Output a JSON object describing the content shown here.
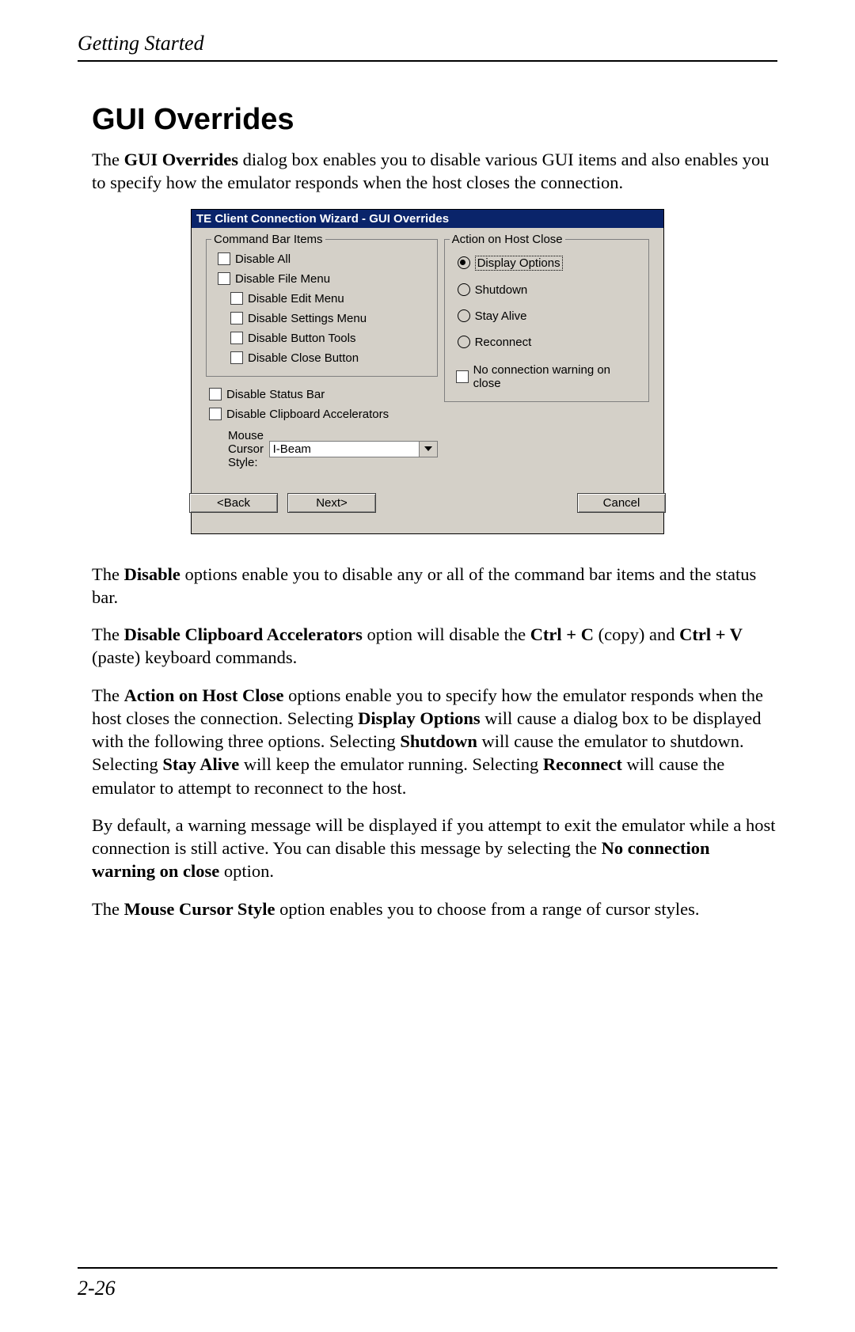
{
  "header": {
    "running_title": "Getting Started"
  },
  "section": {
    "title": "GUI Overrides"
  },
  "intro": {
    "p1_a": "The ",
    "p1_b": "GUI Overrides",
    "p1_c": " dialog box enables you to disable various GUI items and also enables you to specify how the emulator responds when the host closes the connection."
  },
  "dialog": {
    "title": "TE Client Connection Wizard - GUI Overrides",
    "group_cmd": {
      "legend": "Command Bar Items",
      "items": {
        "all": "Disable All",
        "file": "Disable File Menu",
        "edit": "Disable Edit Menu",
        "settings": "Disable Settings Menu",
        "tools": "Disable Button Tools",
        "close": "Disable Close Button"
      }
    },
    "status_bar": "Disable Status Bar",
    "clip_accel": "Disable Clipboard Accelerators",
    "mouse_label": "Mouse Cursor Style:",
    "mouse_value": "I-Beam",
    "group_action": {
      "legend": "Action on Host Close",
      "display": "Display Options",
      "shutdown": "Shutdown",
      "stay": "Stay Alive",
      "reconnect": "Reconnect",
      "nowarn": "No connection warning on close"
    },
    "buttons": {
      "back": "<Back",
      "next": "Next>",
      "cancel": "Cancel"
    }
  },
  "body": {
    "p2_a": "The ",
    "p2_b": "Disable",
    "p2_c": " options enable you to disable any or all of the command bar items and the status bar.",
    "p3_a": "The ",
    "p3_b": "Disable Clipboard Accelerators",
    "p3_c": " option will disable the ",
    "p3_d": "Ctrl + C",
    "p3_e": " (copy) and ",
    "p3_f": "Ctrl + V",
    "p3_g": " (paste) keyboard commands.",
    "p4_a": "The ",
    "p4_b": "Action on Host Close",
    "p4_c": " options enable you to specify how the emulator responds when the host closes the connection. Selecting ",
    "p4_d": "Display Options",
    "p4_e": " will cause a dialog box to be displayed with the following three options. Selecting ",
    "p4_f": "Shutdown",
    "p4_g": " will cause the emulator to shutdown. Selecting ",
    "p4_h": "Stay Alive",
    "p4_i": " will keep the emulator running. Selecting ",
    "p4_j": "Reconnect",
    "p4_k": " will cause the emulator to attempt to reconnect to the host.",
    "p5_a": "By default, a warning message will be displayed if you attempt to exit the emulator while a host connection is still active. You can disable this message by selecting the ",
    "p5_b": "No connection warning on close",
    "p5_c": " option.",
    "p6_a": "The ",
    "p6_b": "Mouse Cursor Style",
    "p6_c": " option enables you to choose from a range of cursor styles."
  },
  "footer": {
    "page_number": "2-26"
  }
}
